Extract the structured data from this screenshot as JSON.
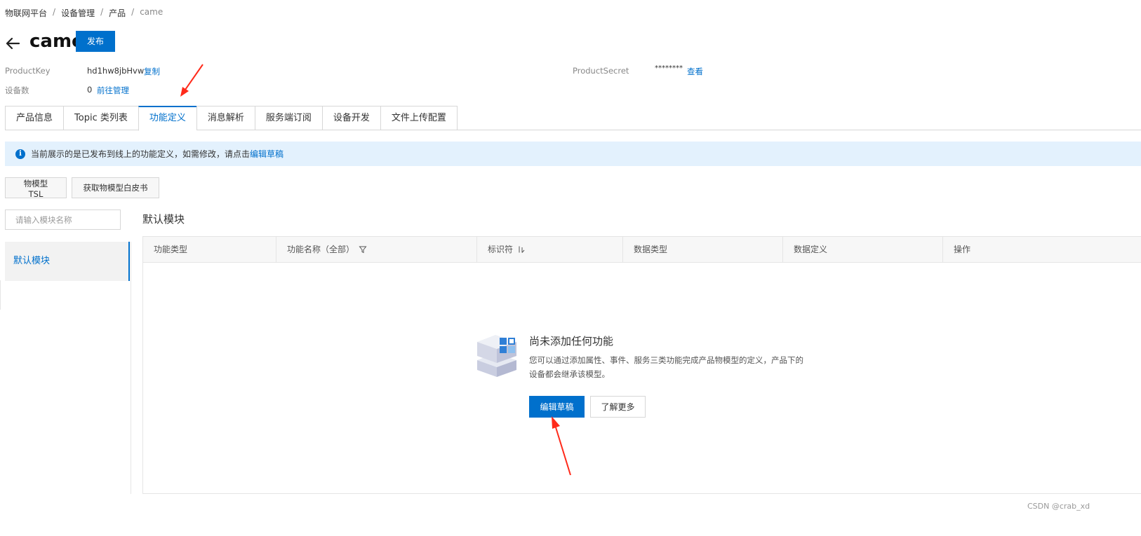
{
  "breadcrumb": {
    "item1": "物联网平台",
    "item2": "设备管理",
    "item3": "产品",
    "item4": "came",
    "sep": "/"
  },
  "header": {
    "title": "came",
    "publish_label": "发布"
  },
  "info": {
    "product_key_label": "ProductKey",
    "product_key_value": "hd1hw8jbHvw",
    "copy_label": "复制",
    "device_count_label": "设备数",
    "device_count_value": "0",
    "manage_link": "前往管理",
    "product_secret_label": "ProductSecret",
    "product_secret_value": "********",
    "view_link": "查看"
  },
  "tabs": [
    {
      "label": "产品信息"
    },
    {
      "label": "Topic 类列表"
    },
    {
      "label": "功能定义"
    },
    {
      "label": "消息解析"
    },
    {
      "label": "服务端订阅"
    },
    {
      "label": "设备开发"
    },
    {
      "label": "文件上传配置"
    }
  ],
  "active_tab": "功能定义",
  "notice": {
    "text": "当前展示的是已发布到线上的功能定义，如需修改，请点击",
    "link": "编辑草稿"
  },
  "actions": {
    "tsl_label": "物模型 TSL",
    "whitepaper_label": "获取物模型白皮书"
  },
  "module_sidebar": {
    "search_placeholder": "请输入模块名称",
    "items": [
      {
        "label": "默认模块"
      }
    ]
  },
  "module_title": "默认模块",
  "table": {
    "columns": [
      {
        "label": "功能类型"
      },
      {
        "label": "功能名称（全部）"
      },
      {
        "label": "标识符"
      },
      {
        "label": "数据类型"
      },
      {
        "label": "数据定义"
      },
      {
        "label": "操作"
      }
    ]
  },
  "empty_state": {
    "title": "尚未添加任何功能",
    "description": "您可以通过添加属性、事件、服务三类功能完成产品物模型的定义，产品下的设备都会继承该模型。",
    "edit_label": "编辑草稿",
    "more_label": "了解更多"
  },
  "watermark": "CSDN @crab_xd",
  "colors": {
    "accent": "#0070cc",
    "notice_bg": "#e3f1fd",
    "annotation": "#ff2a1a"
  }
}
